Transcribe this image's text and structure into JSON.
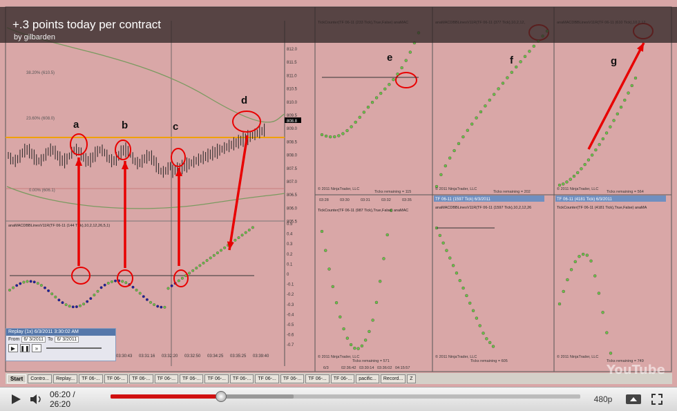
{
  "video": {
    "title": "+.3 points today per contract",
    "byline": "by gilbarden",
    "labels": [
      "a",
      "b",
      "c",
      "d",
      "e",
      "f",
      "g"
    ],
    "left_panel_headers": {
      "top": "HLCLines(TF 06-11 (144 Tick),2) anaKeltnerUniversal(TF 06-11 (144 Tick),30,EMA,EMA,3,1,0)",
      "bottom": "anaMACDBBLinesV11R(TF 06-11 (144 Tick),10,2,12,26,5,1)"
    },
    "fib_labels": [
      "38.20% (610.5)",
      "23.60% (608.0)",
      "0.00% (606.1)"
    ],
    "price_axis": [
      "812.0",
      "811.5",
      "811.0",
      "810.5",
      "810.0",
      "809.5",
      "809.0",
      "808.5",
      "808.0",
      "807.5",
      "807.0",
      "806.5",
      "806.0",
      "805.5"
    ],
    "price_current": "808.8",
    "macd_axis": [
      "0.5",
      "0.4",
      "0.3",
      "0.2",
      "0.1",
      "0",
      "-0.1",
      "-0.2",
      "-0.3",
      "-0.4",
      "-0.5",
      "-0.6",
      "-0.7"
    ],
    "time_axis": [
      "03:30:43",
      "03:31:16",
      "03:32:20",
      "03:32:50",
      "03:34:25",
      "03:35:25",
      "03:39:40"
    ],
    "panels": {
      "p1": "TickCounter(TF 06-11 (233 Tick),True,False) anaMAC",
      "p2": "anaMACDBBLinesV11R(TF 06-11 (377 Tick),10,2,12,",
      "p3": "anaMACDBBLinesV11R(TF 06-11 (610 Tick),10,2,12,",
      "p4": "TickCounter(TF 06-11 (987 Tick),True,False) anaMAC",
      "p5": "anaMACDBBLinesV11R(TF 06-11 (1597 Tick),10,2,12,26",
      "p6": "TickCounter(TF 06-11 (4181 Tick),True,False) anaMA"
    },
    "window_titles": {
      "w5": "TF 06-11 (1597 Tick) 6/3/2011",
      "w6": "TF 06-11 (4181 Tick) 6/3/2011"
    },
    "ticks_remaining": [
      "Ticks remaining = 115",
      "Ticks remaining = 202",
      "Ticks remaining = 564",
      "Ticks remaining = 571",
      "Ticks remaining = 605",
      "Ticks remaining = 749"
    ],
    "copyright": "© 2011 NinjaTrader, LLC",
    "p1_time_axis": [
      "03:28",
      "03:30",
      "03:31",
      "03:32",
      "03:35"
    ],
    "p4_time_axis": [
      "6/3",
      "02:36:42",
      "03:30:14",
      "03:36:02",
      "04:15:57"
    ]
  },
  "replay": {
    "header": "Replay (1x) 6/3/2011 3:30:02 AM",
    "from_label": "From",
    "from_value": "6/ 3/2011",
    "to_label": "To",
    "to_value": "6/ 3/2011"
  },
  "taskbar": {
    "start": "Start",
    "items": [
      "Contro...",
      "Replay...",
      "TF 06-...",
      "TF 06-...",
      "TF 06-...",
      "TF 06-...",
      "TF 06-...",
      "TF 06-...",
      "TF 06-...",
      "TF 06-...",
      "TF 06-...",
      "TF 06-...",
      "TF 06-...",
      "pacific...",
      "Record...",
      "Z"
    ]
  },
  "controls": {
    "time": "06:20 / 26:20",
    "progress_played": 0.236,
    "progress_loaded": 0.39,
    "quality": "480p"
  },
  "youtube_logo": "YouTube",
  "colors": {
    "chart_bg": "#d9a7a7",
    "annotation": "#e80000",
    "up_dot": "#6ec04a",
    "down_dot": "#2020a0",
    "fib_line": "#f0a000"
  }
}
